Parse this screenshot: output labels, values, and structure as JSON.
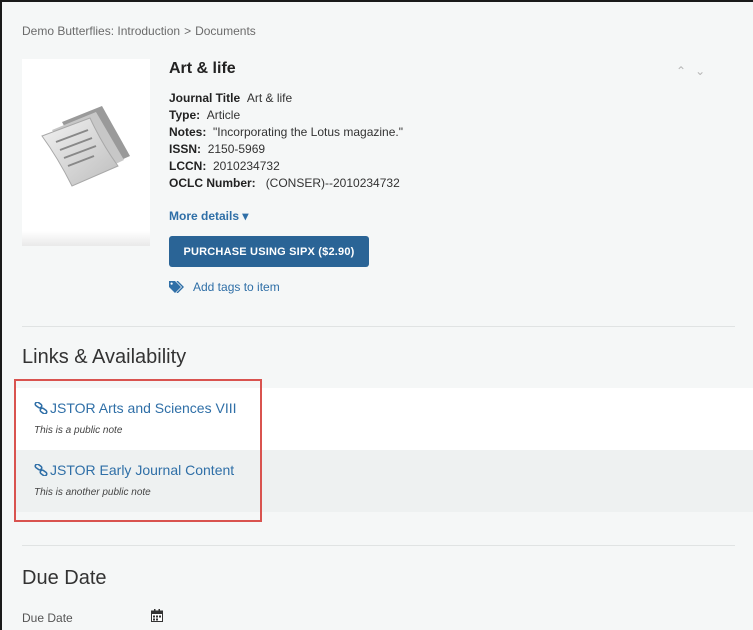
{
  "breadcrumb": {
    "items": [
      "Demo Butterflies: Introduction",
      "Documents"
    ],
    "separator": ">"
  },
  "record": {
    "title": "Art & life",
    "fields": [
      {
        "label": "Journal Title",
        "value": "Art & life"
      },
      {
        "label": "Type:",
        "value": "Article"
      },
      {
        "label": "Notes:",
        "value": "\"Incorporating the Lotus magazine.\""
      },
      {
        "label": "ISSN:",
        "value": "2150-5969"
      },
      {
        "label": "LCCN:",
        "value": "2010234732"
      },
      {
        "label": "OCLC Number:",
        "value": "(CONSER)--2010234732"
      }
    ],
    "more_details": "More details ▾",
    "purchase_button": "PURCHASE USING SIPX ($2.90)",
    "add_tags": "Add tags to item",
    "icons": [
      "document-thumbnail-icon",
      "tag-icon",
      "chevron-up-icon",
      "chevron-down-icon"
    ]
  },
  "links_section": {
    "heading": "Links & Availability",
    "links": [
      {
        "title": "JSTOR Arts and Sciences VIII",
        "note": "This is a public note"
      },
      {
        "title": "JSTOR Early Journal Content",
        "note": "This is another public note"
      }
    ],
    "icon": "link-icon"
  },
  "due_section": {
    "heading": "Due Date",
    "field_label": "Due Date",
    "icon": "calendar-icon"
  },
  "colors": {
    "link": "#2f6fa7",
    "button": "#2a6496",
    "highlight": "#d9534f",
    "panel": "#f5f7f7"
  }
}
